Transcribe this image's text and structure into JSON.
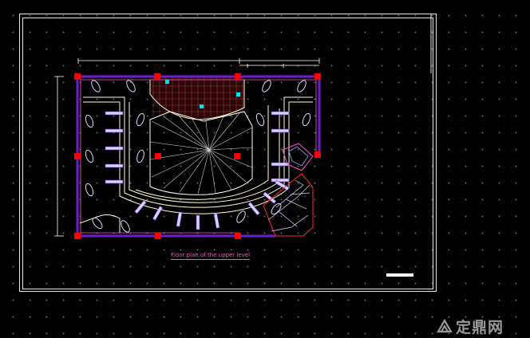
{
  "drawing": {
    "title": "Floor plan of the upper level",
    "title_color": "#ff4fd0",
    "background_color": "#000000",
    "frame_color": "#ffffff",
    "wall_color": "#6a1fd1",
    "column_color": "#ff0000",
    "contour_color": "#ffffcc",
    "glass_color": "#d4d4ff",
    "marker_color": "#00e5e5",
    "hatch_color": "#ff2a2a"
  },
  "watermark": {
    "text": "定鼎网",
    "logo": "dingding-logo"
  }
}
